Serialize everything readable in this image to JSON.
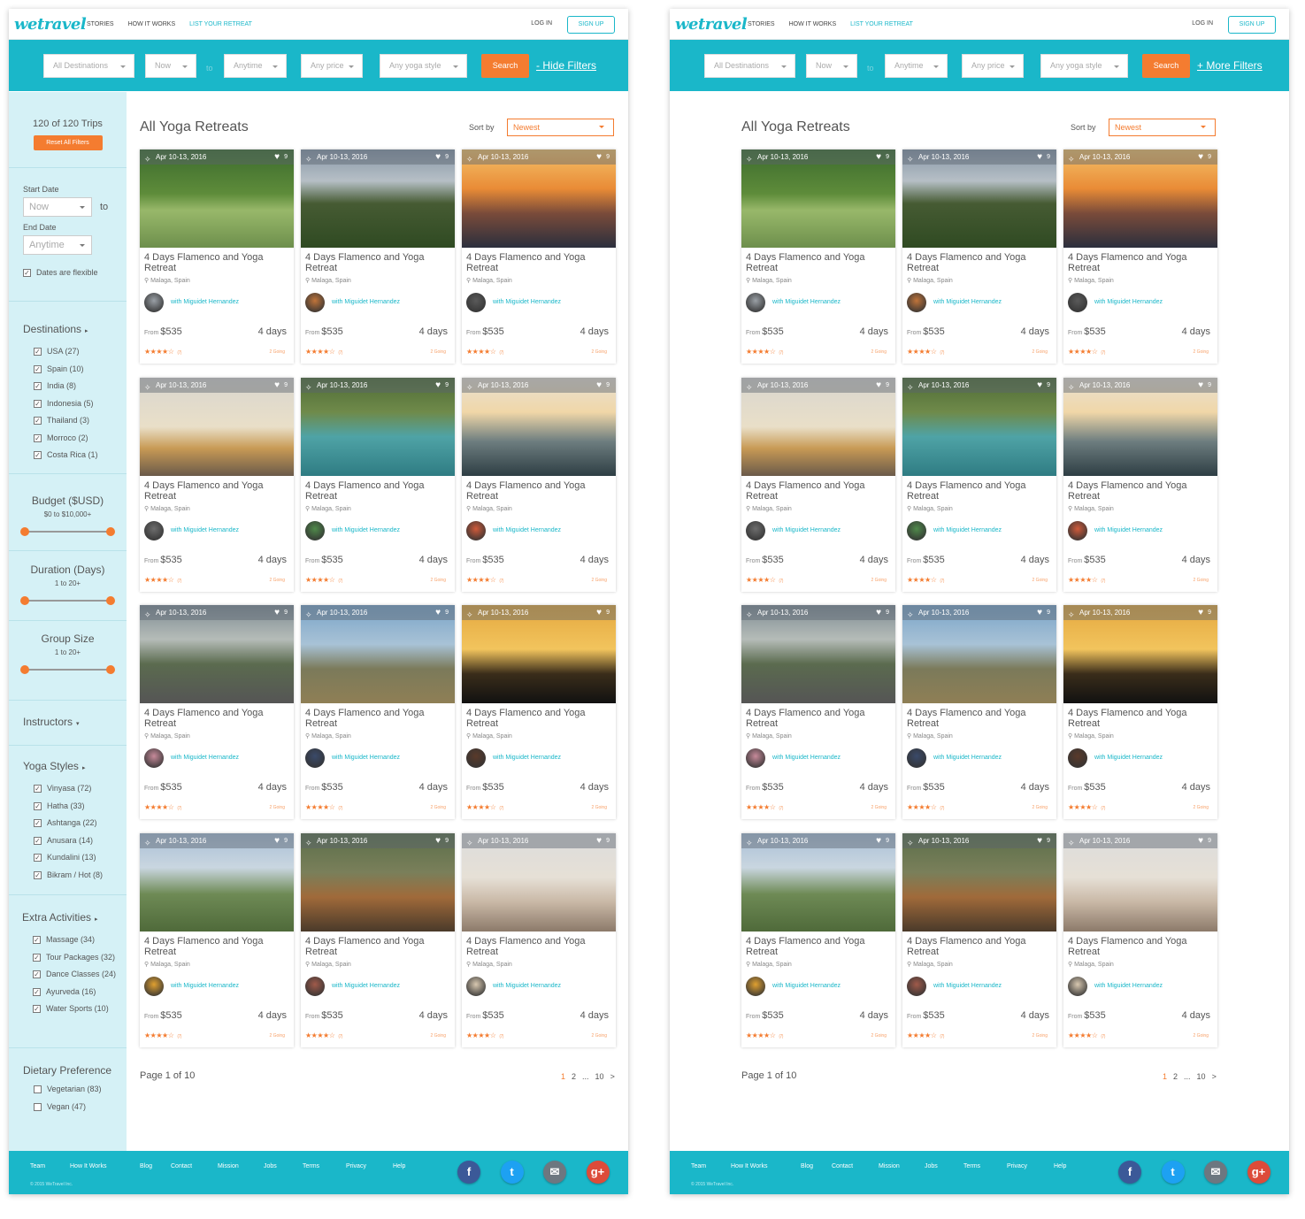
{
  "logo": "wetravel",
  "nav": {
    "stories": "STORIES",
    "how": "HOW IT WORKS",
    "list": "LIST YOUR RETREAT",
    "login": "LOG IN",
    "signup": "SIGN UP"
  },
  "filters": {
    "destinations": "All Destinations",
    "start": "Now",
    "to": "to",
    "end": "Anytime",
    "price": "Any price",
    "style": "Any yoga style",
    "search": "Search",
    "hide": "- Hide Filters",
    "more": "+ More Filters"
  },
  "sidebar": {
    "count": "120 of 120 Trips",
    "reset": "Reset All Filters",
    "start_label": "Start Date",
    "start_value": "Now",
    "to": "to",
    "end_label": "End Date",
    "end_value": "Anytime",
    "flexible": "Dates are flexible",
    "destinations_title": "Destinations",
    "destinations": [
      "USA (27)",
      "Spain (10)",
      "India (8)",
      "Indonesia (5)",
      "Thailand (3)",
      "Morroco (2)",
      "Costa Rica (1)"
    ],
    "budget_title": "Budget ($USD)",
    "budget_range": "$0 to $10,000+",
    "duration_title": "Duration (Days)",
    "duration_range": "1 to 20+",
    "group_title": "Group Size",
    "group_range": "1 to 20+",
    "instructors_title": "Instructors",
    "styles_title": "Yoga Styles",
    "styles": [
      "Vinyasa (72)",
      "Hatha (33)",
      "Ashtanga (22)",
      "Anusara (14)",
      "Kundalini (13)",
      "Bikram / Hot (8)"
    ],
    "extra_title": "Extra Activities",
    "extra": [
      "Massage (34)",
      "Tour Packages (32)",
      "Dance Classes (24)",
      "Ayurveda (16)",
      "Water Sports (10)"
    ],
    "diet_title": "Dietary Preference",
    "diet": [
      "Vegetarian (83)",
      "Vegan (47)"
    ]
  },
  "main": {
    "title": "All Yoga Retreats",
    "sort_label": "Sort by",
    "sort_value": "Newest"
  },
  "card": {
    "date": "Apr 10-13, 2016",
    "likes": "9",
    "title": "4 Days Flamenco and Yoga Retreat",
    "location": "Malaga, Spain",
    "instructor": "with Miguidet Hernandez",
    "from": "From",
    "price": "$535",
    "days": "4 days",
    "reviews": "(7)",
    "going": "2 Going",
    "rating": 4
  },
  "pagination": {
    "label": "Page 1 of 10",
    "pages": [
      "1",
      "2",
      "...",
      "10",
      ">"
    ]
  },
  "footer": {
    "links": [
      "Team",
      "How It Works",
      "Blog",
      "Contact",
      "Mission",
      "Jobs",
      "Terms",
      "Privacy",
      "Help"
    ],
    "copyright": "© 2015 WeTravel Inc.",
    "social": [
      {
        "name": "facebook-icon",
        "glyph": "f",
        "color": "#3b5998"
      },
      {
        "name": "twitter-icon",
        "glyph": "t",
        "color": "#1da1f2"
      },
      {
        "name": "email-icon",
        "glyph": "✉",
        "color": "#6d7780"
      },
      {
        "name": "google-plus-icon",
        "glyph": "g+",
        "color": "#dd4b39"
      }
    ]
  },
  "colors": {
    "brand": "#1ab7c9",
    "accent": "#f47c30"
  }
}
